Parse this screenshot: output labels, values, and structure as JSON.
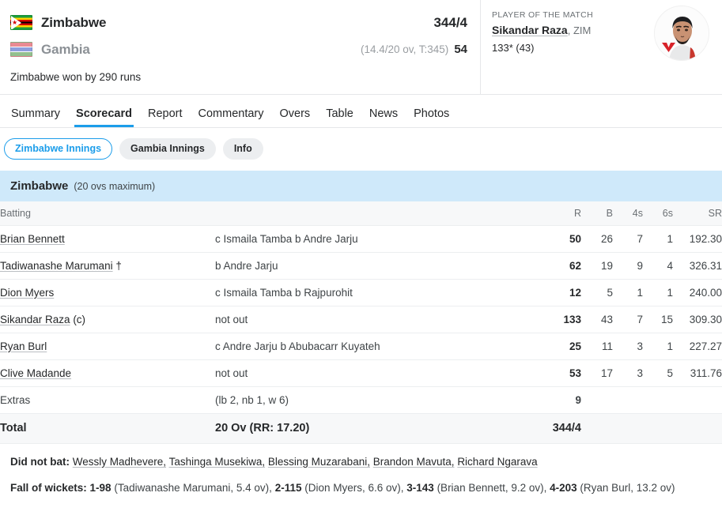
{
  "match_header": {
    "teams": [
      {
        "name": "Zimbabwe",
        "flag": "zimbabwe-flag",
        "score": "344/4",
        "meta": ""
      },
      {
        "name": "Gambia",
        "flag": "gambia-flag",
        "score": "54",
        "meta": "(14.4/20 ov, T:345)"
      }
    ],
    "result": "Zimbabwe won by 290 runs"
  },
  "player_of_the_match": {
    "label": "PLAYER OF THE MATCH",
    "name": "Sikandar Raza",
    "team": ", ZIM",
    "figures": "133* (43)"
  },
  "tabs": [
    {
      "label": "Summary",
      "active": false
    },
    {
      "label": "Scorecard",
      "active": true
    },
    {
      "label": "Report",
      "active": false
    },
    {
      "label": "Commentary",
      "active": false
    },
    {
      "label": "Overs",
      "active": false
    },
    {
      "label": "Table",
      "active": false
    },
    {
      "label": "News",
      "active": false
    },
    {
      "label": "Photos",
      "active": false
    }
  ],
  "innings_chips": [
    {
      "label": "Zimbabwe Innings",
      "active": true
    },
    {
      "label": "Gambia Innings",
      "active": false
    },
    {
      "label": "Info",
      "active": false
    }
  ],
  "innings": {
    "team": "Zimbabwe",
    "overs_note": "(20 ovs maximum)",
    "columns": {
      "batting": "Batting",
      "r": "R",
      "b": "B",
      "fours": "4s",
      "sixes": "6s",
      "sr": "SR"
    },
    "batsmen": [
      {
        "name": "Brian Bennett",
        "role": "",
        "dismissal": "c Ismaila Tamba b Andre Jarju",
        "r": "50",
        "b": "26",
        "fours": "7",
        "sixes": "1",
        "sr": "192.30"
      },
      {
        "name": "Tadiwanashe Marumani",
        "role": " †",
        "dismissal": "b Andre Jarju",
        "r": "62",
        "b": "19",
        "fours": "9",
        "sixes": "4",
        "sr": "326.31"
      },
      {
        "name": "Dion Myers",
        "role": "",
        "dismissal": "c Ismaila Tamba b Rajpurohit",
        "r": "12",
        "b": "5",
        "fours": "1",
        "sixes": "1",
        "sr": "240.00"
      },
      {
        "name": "Sikandar Raza",
        "role": " (c)",
        "dismissal": "not out",
        "r": "133",
        "b": "43",
        "fours": "7",
        "sixes": "15",
        "sr": "309.30"
      },
      {
        "name": "Ryan Burl",
        "role": "",
        "dismissal": "c Andre Jarju b Abubacarr Kuyateh",
        "r": "25",
        "b": "11",
        "fours": "3",
        "sixes": "1",
        "sr": "227.27"
      },
      {
        "name": "Clive Madande",
        "role": "",
        "dismissal": "not out",
        "r": "53",
        "b": "17",
        "fours": "3",
        "sixes": "5",
        "sr": "311.76"
      }
    ],
    "extras": {
      "label": "Extras",
      "detail": "(lb 2, nb 1, w 6)",
      "value": "9"
    },
    "total": {
      "label": "Total",
      "detail": "20 Ov (RR: 17.20)",
      "value": "344/4"
    }
  },
  "notes": {
    "did_not_bat_label": "Did not bat:",
    "did_not_bat": [
      "Wessly Madhevere,",
      "Tashinga Musekiwa,",
      "Blessing Muzarabani,",
      "Brandon Mavuta,",
      "Richard Ngarava"
    ],
    "fall_of_wickets_label": "Fall of wickets:",
    "fall_of_wickets": [
      {
        "key": "1-98",
        "detail": " (Tadiwanashe Marumani, 5.4 ov), "
      },
      {
        "key": "2-115",
        "detail": " (Dion Myers, 6.6 ov), "
      },
      {
        "key": "3-143",
        "detail": " (Brian Bennett, 9.2 ov), "
      },
      {
        "key": "4-203",
        "detail": " (Ryan Burl, 13.2 ov)"
      }
    ]
  },
  "colors": {
    "accent": "#1b9dea",
    "innings_bar": "#cfe9fa",
    "row_alt": "#f7f8f9"
  }
}
